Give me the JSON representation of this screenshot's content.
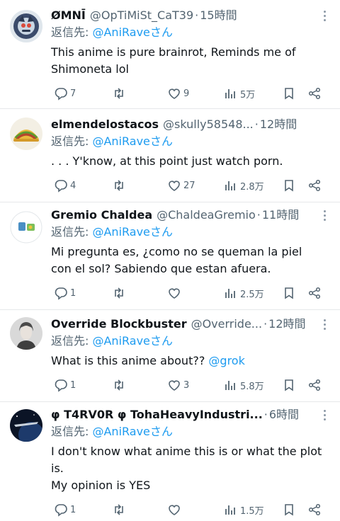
{
  "reply_prefix": "返信先: ",
  "replies": [
    {
      "name": "ØMNĪ",
      "handle": "@OpTiMiSt_CaT39",
      "time": "15時間",
      "reply_to": "@AniRaveさん",
      "text_lines": [
        "This anime is pure brainrot, Reminds me of",
        "Shimoneta lol"
      ],
      "mention_in_text": "",
      "stats": {
        "replies": "7",
        "retweets": "",
        "likes": "9",
        "views": "5万"
      },
      "avatar": "cat-mecha-avatar"
    },
    {
      "name": "elmendelostacos",
      "handle": "@skully58548...",
      "time": "12時間",
      "reply_to": "@AniRaveさん",
      "text_lines": [
        ". . . Y'know, at this point just watch porn."
      ],
      "mention_in_text": "",
      "stats": {
        "replies": "4",
        "retweets": "",
        "likes": "27",
        "views": "2.8万"
      },
      "avatar": "taco-avatar"
    },
    {
      "name": "Gremio Chaldea",
      "handle": "@ChaldeaGremio",
      "time": "11時間",
      "reply_to": "@AniRaveさん",
      "text_lines": [
        "Mi pregunta es, ¿como no se queman la piel",
        "con el sol? Sabiendo que estan afuera."
      ],
      "mention_in_text": "",
      "stats": {
        "replies": "1",
        "retweets": "",
        "likes": "",
        "views": "2.5万"
      },
      "avatar": "logo-avatar"
    },
    {
      "name": "Override Blockbuster",
      "handle": "@Override...",
      "time": "12時間",
      "reply_to": "@AniRaveさん",
      "text_lines": [
        "What is this anime about?? "
      ],
      "mention_in_text": "@grok",
      "stats": {
        "replies": "1",
        "retweets": "",
        "likes": "3",
        "views": "5.8万"
      },
      "avatar": "person-avatar"
    },
    {
      "name": "φ T4RV0R φ TohaHeavyIndustri...",
      "handle": "",
      "time": "6時間",
      "reply_to": "@AniRaveさん",
      "text_lines": [
        "I don't know what anime this is or what the plot",
        "is.",
        "My opinion is YES"
      ],
      "mention_in_text": "",
      "stats": {
        "replies": "1",
        "retweets": "",
        "likes": "",
        "views": "1.5万"
      },
      "avatar": "space-avatar"
    }
  ],
  "colors": {
    "link": "#1d9bf0",
    "secondary": "#536471",
    "divider": "#e6e8ea"
  },
  "icons": [
    "reply-icon",
    "retweet-icon",
    "like-icon",
    "views-icon",
    "bookmark-icon",
    "share-icon",
    "more-icon"
  ]
}
